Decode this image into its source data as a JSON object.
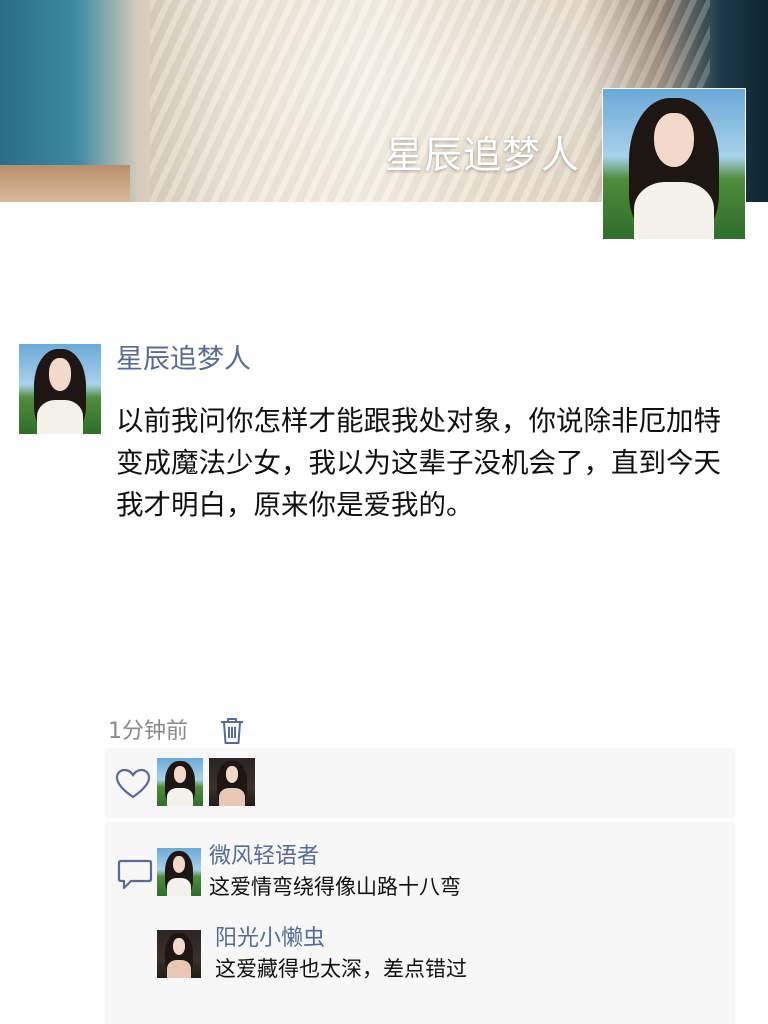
{
  "cover": {
    "display_name": "星辰追梦人"
  },
  "post": {
    "author": "星辰追梦人",
    "text": "以前我问你怎样才能跟我处对象，你说除非厄加特变成魔法少女，我以为这辈子没机会了，直到今天我才明白，原来你是爱我的。",
    "time": "1分钟前"
  },
  "likes": {
    "icon": "heart-outline-icon",
    "count": 2
  },
  "comments": [
    {
      "name": "微风轻语者",
      "text": "这爱情弯绕得像山路十八弯"
    },
    {
      "name": "阳光小懒虫",
      "text": "这爱藏得也太深，差点错过"
    }
  ],
  "colors": {
    "link": "#576b95",
    "panel_bg": "#f7f7f7",
    "meta": "#8a8a8a",
    "text": "#111111"
  }
}
